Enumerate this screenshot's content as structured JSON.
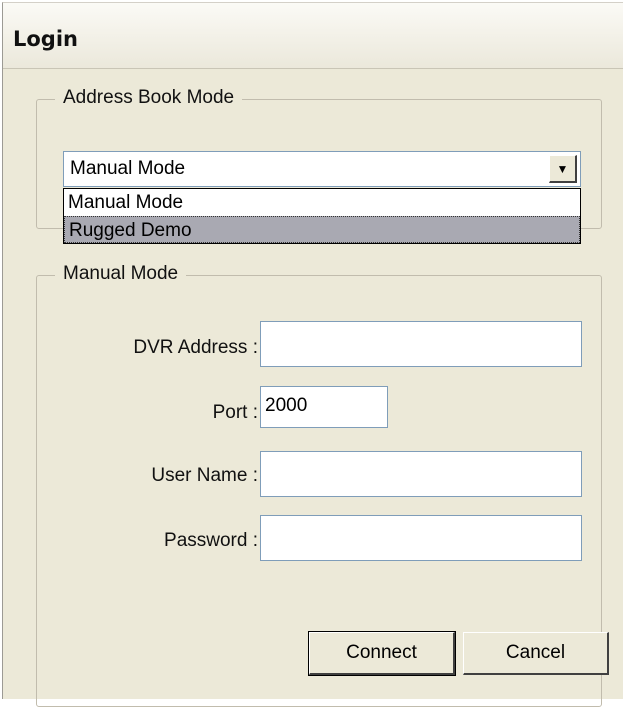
{
  "window": {
    "title": "Login"
  },
  "address_book": {
    "group_title": "Address Book Mode",
    "selected": "Manual Mode",
    "options": [
      "Manual Mode",
      "Rugged Demo"
    ],
    "highlighted": "Rugged Demo"
  },
  "manual": {
    "group_title": "Manual Mode",
    "dvr_address_label": "DVR Address :",
    "dvr_address_value": "",
    "port_label": "Port :",
    "port_value": "2000",
    "username_label": "User Name :",
    "username_value": "",
    "password_label": "Password :",
    "password_value": ""
  },
  "buttons": {
    "connect": "Connect",
    "cancel": "Cancel"
  }
}
